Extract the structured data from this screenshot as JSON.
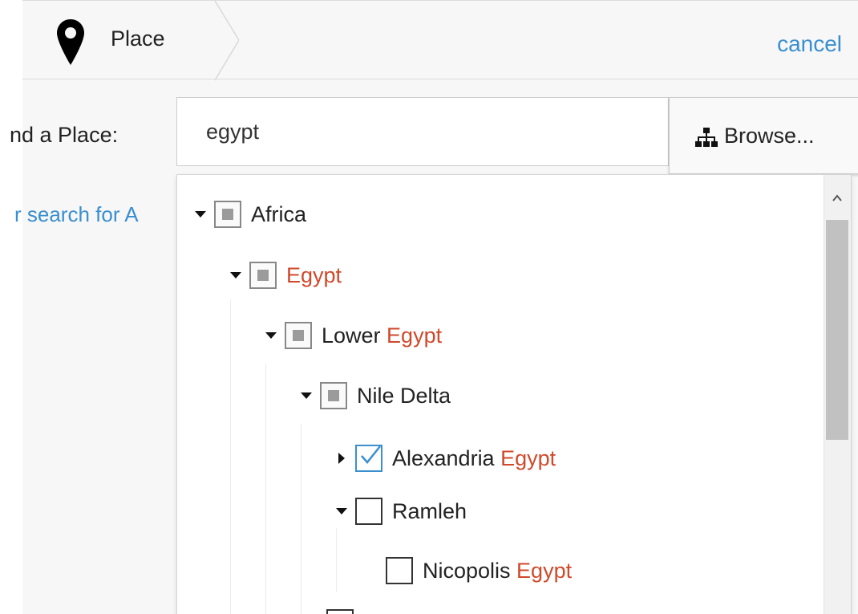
{
  "header": {
    "breadcrumb_label": "Place",
    "breadcrumb_icon": "map-pin-icon",
    "cancel_label": "cancel"
  },
  "finder": {
    "label": "nd a Place:",
    "search_value": "egypt",
    "browse_label": "Browse...",
    "browse_icon": "sitemap-icon",
    "hint": "r search for A"
  },
  "tree": {
    "nodes": [
      {
        "label": "Africa",
        "match": "",
        "state": "partial",
        "expanded": true
      },
      {
        "label": "",
        "match": "Egypt",
        "state": "partial",
        "expanded": true
      },
      {
        "label": "Lower ",
        "match": "Egypt",
        "state": "partial",
        "expanded": true
      },
      {
        "label": "Nile Delta",
        "match": "",
        "state": "partial",
        "expanded": true
      },
      {
        "label": "Alexandria ",
        "match": "Egypt",
        "state": "checked",
        "expanded": false
      },
      {
        "label": "Ramleh",
        "match": "",
        "state": "unchecked",
        "expanded": true
      },
      {
        "label": "Nicopolis ",
        "match": "Egypt",
        "state": "unchecked",
        "expanded": null
      }
    ]
  },
  "colors": {
    "accent": "#3a8fd0",
    "match": "#d0492b",
    "background": "#f7f7f7",
    "partial_fill": "#9b9b9b"
  }
}
